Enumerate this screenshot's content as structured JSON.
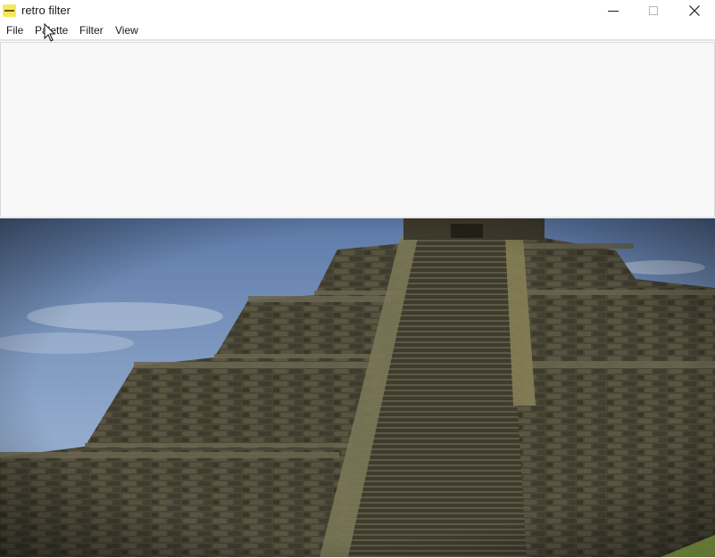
{
  "window": {
    "title": "retro filter",
    "icon": "app-icon-yellow",
    "controls": [
      "minimize-icon",
      "maximize-icon",
      "close-icon"
    ]
  },
  "menu": {
    "items": [
      {
        "label": "File"
      },
      {
        "label": "Palette"
      },
      {
        "label": "Filter"
      },
      {
        "label": "View"
      }
    ]
  },
  "image": {
    "subject": "stepped stone pyramid against a blue sky"
  },
  "colors": {
    "sky": "#8aa3c6",
    "stone": "#4a4636",
    "stone_dark": "#2a271e",
    "panel": "#f8f8f8"
  }
}
